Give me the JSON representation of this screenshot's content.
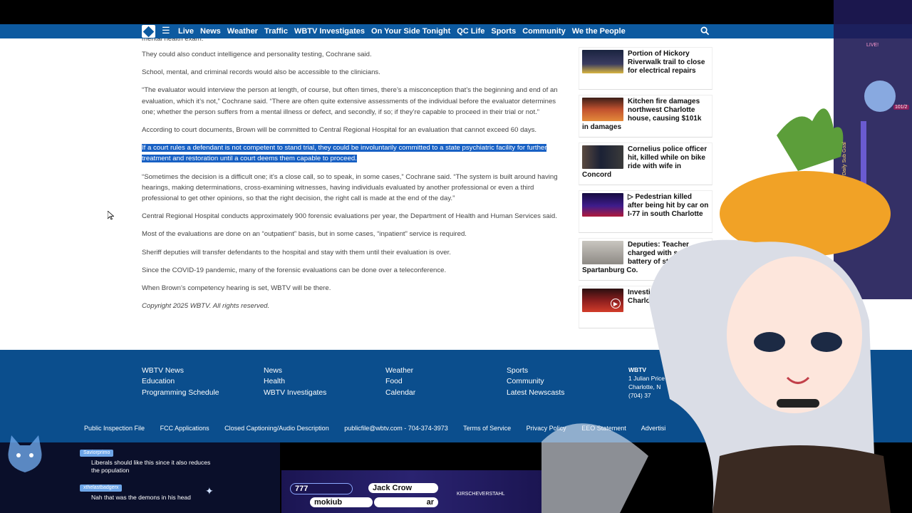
{
  "nav": {
    "links": [
      "Live",
      "News",
      "Weather",
      "Traffic",
      "WBTV Investigates",
      "On Your Side Tonight",
      "QC Life",
      "Sports",
      "Community",
      "We the People"
    ]
  },
  "article": {
    "top_cut": "mental health exam.",
    "p1": "They could also conduct intelligence and personality testing, Cochrane said.",
    "p2": "School, mental, and criminal records would also be accessible to the clinicians.",
    "p3": "“The evaluator would interview the person at length, of course, but often times, there’s a misconception that’s the beginning and end of an evaluation, which it’s not,” Cochrane said. “There are often quite extensive assessments of the individual before the evaluator determines one; whether the person suffers from a mental illness or defect, and secondly, if so; if they’re capable to proceed in their trial or not.”",
    "p4": "According to court documents, Brown will be committed to Central Regional Hospital for an evaluation that cannot exceed 60 days.",
    "p5": "If a court rules a defendant is not competent to stand trial, they could be involuntarily committed to a state psychiatric facility for further treatment and restoration until a court deems them capable to proceed.",
    "p6": "“Sometimes the decision is a difficult one; it’s a close call, so to speak, in some cases,” Cochrane said. “The system is built around having hearings, making determinations, cross-examining witnesses, having individuals evaluated by another professional or even a third professional to get other opinions, so that the right decision, the right call is made at the end of the day.”",
    "p7": "Central Regional Hospital conducts approximately 900 forensic evaluations per year, the Department of Health and Human Services said.",
    "p8": "Most of the evaluations are done on an “outpatient” basis, but in some cases, “inpatient” service is required.",
    "p9": "Sheriff deputies will transfer defendants to the hospital and stay with them until their evaluation is over.",
    "p10": "Since the COVID-19 pandemic, many of the forensic evaluations can be done over a teleconference.",
    "p11": "When Brown’s competency hearing is set, WBTV will be there.",
    "copyright": "Copyright 2025 WBTV. All rights reserved."
  },
  "sidebar": {
    "stories": [
      {
        "title": "Portion of Hickory Riverwalk trail to close for electrical repairs"
      },
      {
        "title": "Kitchen fire damages northwest Charlotte house, causing $101k in damages"
      },
      {
        "title": "Cornelius police officer hit, killed while on bike ride with wife in Concord"
      },
      {
        "title": "Pedestrian killed after being hit by car on I-77 in south Charlotte"
      },
      {
        "title": "Deputies: Teacher charged with sexual battery of student in Spartanburg Co."
      },
      {
        "title": "Investi after  hous Charlotte"
      }
    ]
  },
  "footer": {
    "col1": [
      "WBTV News",
      "Education",
      "Programming Schedule"
    ],
    "col2": [
      "News",
      "Health",
      "WBTV Investigates"
    ],
    "col3": [
      "Weather",
      "Food",
      "Calendar"
    ],
    "col4": [
      "Sports",
      "Community",
      "Latest Newscasts"
    ],
    "station": "WBTV",
    "address1": "1 Julian Price Pl.",
    "address2": "Charlotte, N",
    "phone": "(704) 37",
    "links": [
      "Public Inspection File",
      "FCC Applications",
      "Closed Captioning/Audio Description",
      "publicfile@wbtv.com - 704-374-3973",
      "Terms of Service",
      "Privacy Policy",
      "EEO Statement",
      "Advertisi"
    ]
  },
  "stream": {
    "chat": [
      {
        "user": "Saviorprimo",
        "message": "Liberals should like this since it also reduces the population"
      },
      {
        "user": "xthelastbadgerx",
        "message": "Nah that was the demons in his head"
      }
    ],
    "bar_left_top": "777",
    "bar_left_bottom": "mokiub",
    "bar_name": "Jack Crow",
    "bar_sub": "ar",
    "bar_right": "KIRSCHEVERSTAHL",
    "live_badge": "LIVE!",
    "sub_goal": "Daily Sub Goal",
    "sub_count": "101/2"
  }
}
